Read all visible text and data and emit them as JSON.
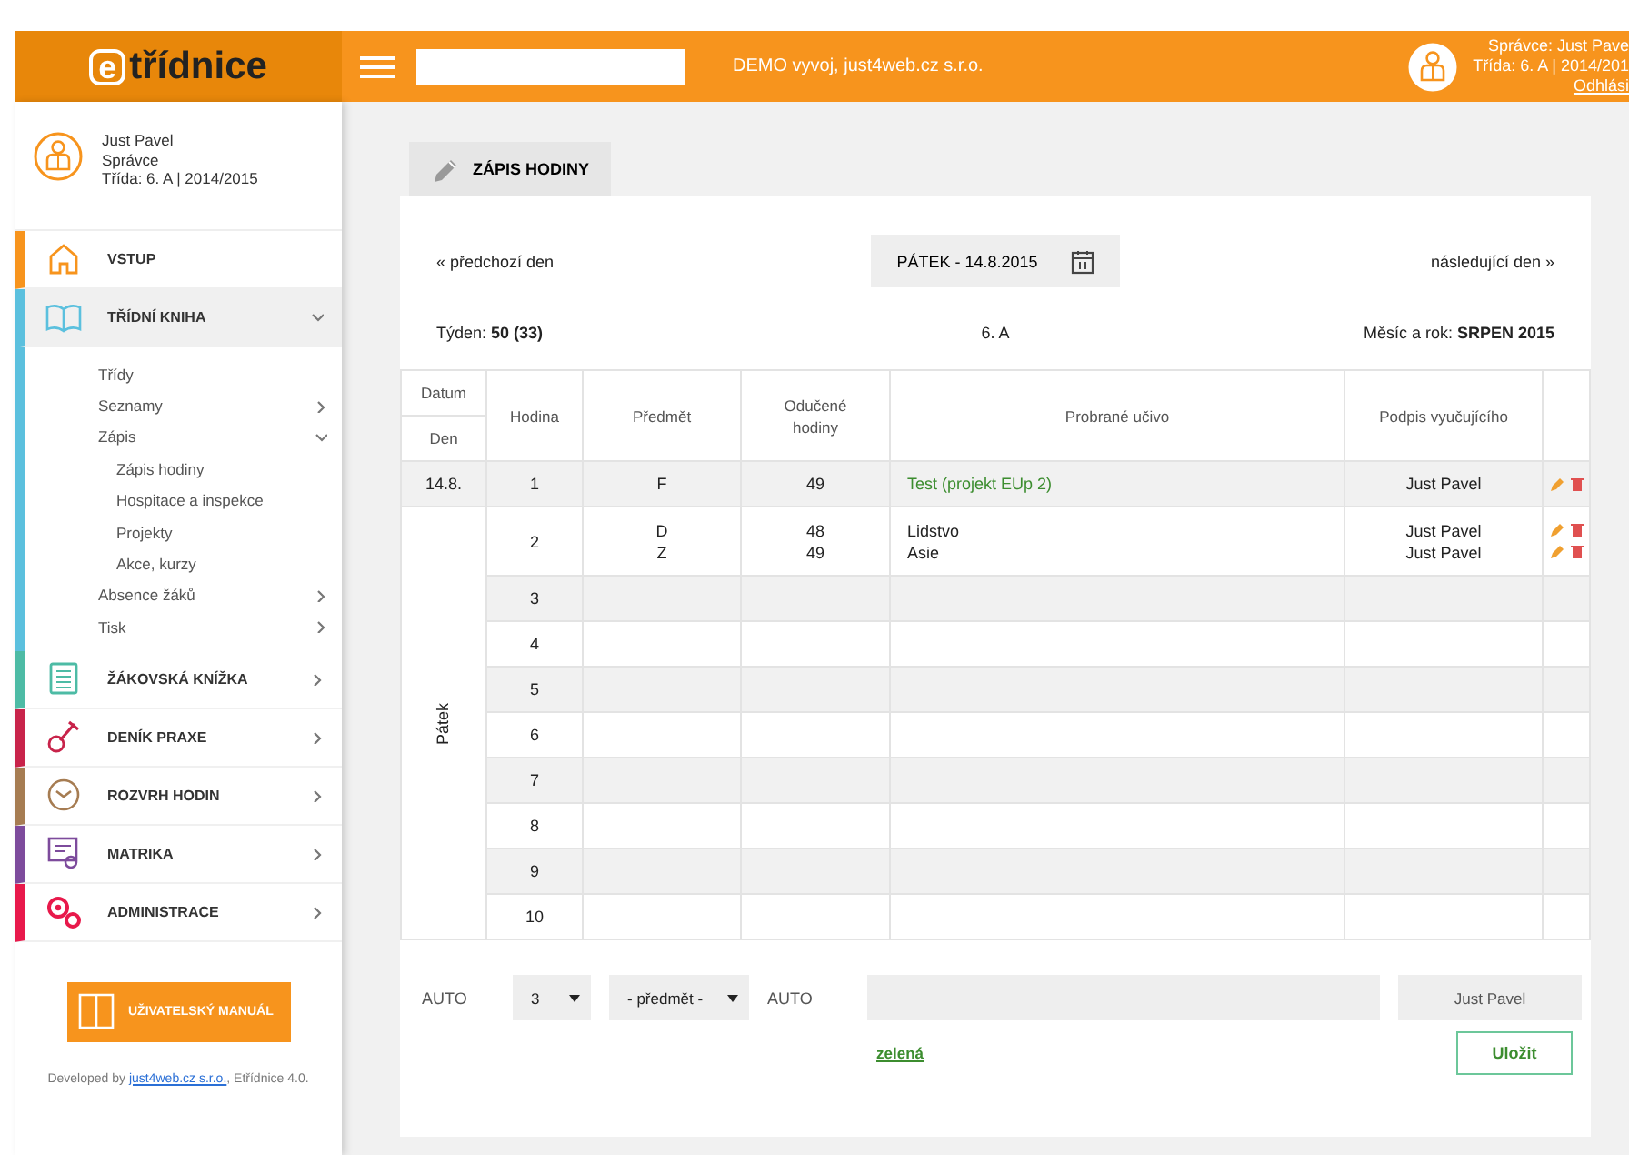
{
  "header": {
    "logo_mark": "e",
    "logo_text": "třídnice",
    "center_text": "DEMO vyvoj, just4web.cz s.r.o.",
    "user_lines": [
      "Správce: Just Pave",
      "Třída: 6. A | 2014/201"
    ],
    "logout": "Odhlási"
  },
  "sidebar": {
    "user": {
      "name": "Just Pavel",
      "role": "Správce",
      "class": "Třída: 6. A | 2014/2015"
    },
    "menu": [
      {
        "label": "VSTUP",
        "kind": "link",
        "color": "#f7941d"
      },
      {
        "label": "TŘÍDNÍ KNIHA",
        "kind": "section",
        "color": "#5bc0de",
        "expanded": true,
        "children": [
          {
            "label": "Třídy"
          },
          {
            "label": "Seznamy",
            "expanded": false
          },
          {
            "label": "Zápis",
            "expanded": true,
            "children": [
              {
                "label": "Zápis hodiny"
              },
              {
                "label": "Hospitace a inspekce"
              },
              {
                "label": "Projekty"
              },
              {
                "label": "Akce, kurzy"
              }
            ]
          },
          {
            "label": "Absence žáků",
            "expanded": false
          },
          {
            "label": "Tisk",
            "expanded": false
          }
        ]
      },
      {
        "label": "ŽÁKOVSKÁ KNÍŽKA",
        "kind": "section",
        "color": "#4dbba5",
        "expanded": false
      },
      {
        "label": "DENÍK PRAXE",
        "kind": "section",
        "color": "#c8234a",
        "expanded": false
      },
      {
        "label": "ROZVRH HODIN",
        "kind": "section",
        "color": "#a67c52",
        "expanded": false
      },
      {
        "label": "MATRIKA",
        "kind": "section",
        "color": "#7d4b9c",
        "expanded": false
      },
      {
        "label": "ADMINISTRACE",
        "kind": "section",
        "color": "#e8194b",
        "expanded": false
      }
    ],
    "manual_button": "UŽIVATELSKÝ MANUÁL",
    "footer": {
      "prefix": "Developed by",
      "link": "just4web.cz s.r.o.",
      "suffix": ", Etřídnice 4.0."
    }
  },
  "main": {
    "tab": {
      "label": "ZÁPIS HODINY",
      "selected": true
    },
    "nav": {
      "previous": "« předchozí den",
      "date": "PÁTEK - 14.8.2015",
      "next": "následující den »"
    },
    "info": {
      "week": "Týden: **50 (33)**",
      "class": "6. A",
      "month": "Měsíc a rok: **SRPEN 2015**"
    },
    "table": {
      "date_header": "Datum",
      "day_header": "Den",
      "columns": [
        "Hodina",
        "Předmět",
        "Odučené hodiny",
        "Probrané učivo",
        "Podpis vyučujícího"
      ],
      "day": "Pátek",
      "rows": [
        {
          "date": "14.8.",
          "hour": "1",
          "entries": [
            {
              "subject": "F",
              "count": "49",
              "topic": "Test (projekt EUp 2)",
              "kind": "project",
              "teacher": "Just Pavel"
            }
          ]
        },
        {
          "hour": "2",
          "entries": [
            {
              "subject": "D",
              "count": "48",
              "topic": "Lidstvo",
              "kind": "lesson",
              "teacher": "Just Pavel"
            },
            {
              "subject": "Z",
              "count": "49",
              "topic": "Asie",
              "kind": "lesson",
              "teacher": "Just Pavel"
            }
          ]
        },
        {
          "hour": "3"
        },
        {
          "hour": "4"
        },
        {
          "hour": "5"
        },
        {
          "hour": "6"
        },
        {
          "hour": "7"
        },
        {
          "hour": "8"
        },
        {
          "hour": "9"
        },
        {
          "hour": "10"
        }
      ]
    },
    "form": {
      "fields": [
        {
          "kind": "label",
          "text": "AUTO"
        },
        {
          "kind": "select",
          "value": "3"
        },
        {
          "kind": "select",
          "value": "- předmět -"
        },
        {
          "kind": "label",
          "text": "AUTO"
        },
        {
          "kind": "input"
        },
        {
          "kind": "input",
          "value": "Just Pavel"
        }
      ],
      "link": "zelená",
      "save_button": "Uložit"
    }
  }
}
